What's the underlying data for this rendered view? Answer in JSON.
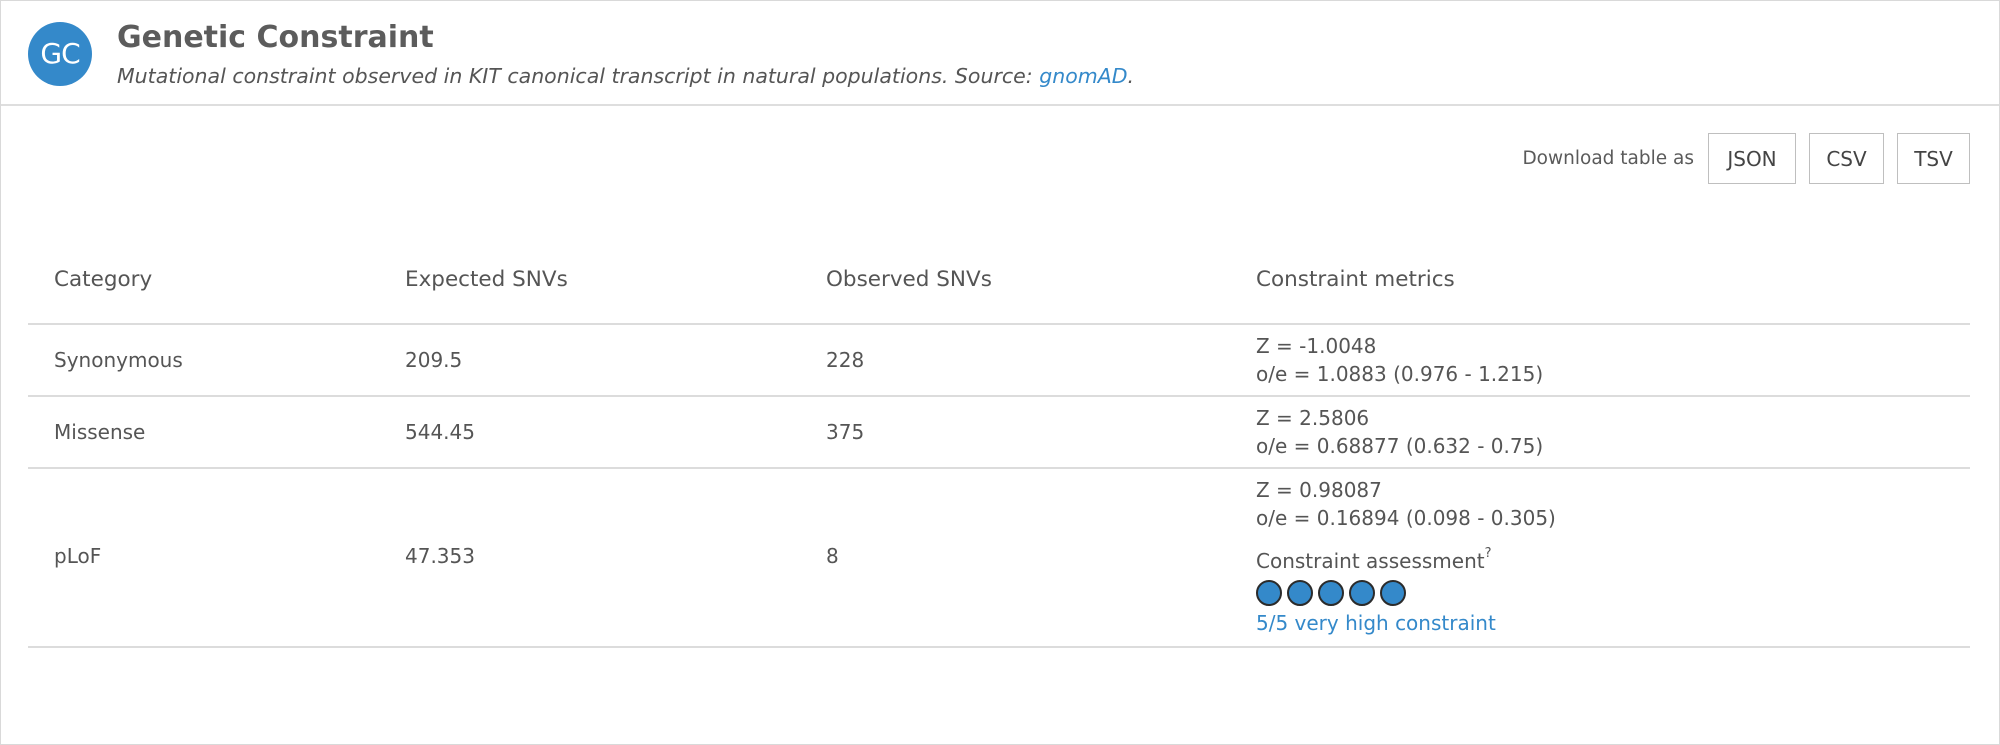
{
  "header": {
    "avatar_text": "GC",
    "title": "Genetic Constraint",
    "subtitle_prefix": "Mutational constraint observed in KIT canonical transcript in natural populations. Source: ",
    "subtitle_link": "gnomAD",
    "subtitle_suffix": "."
  },
  "download": {
    "label": "Download table as",
    "buttons": [
      "JSON",
      "CSV",
      "TSV"
    ]
  },
  "table": {
    "columns": [
      "Category",
      "Expected SNVs",
      "Observed SNVs",
      "Constraint metrics"
    ],
    "rows": [
      {
        "category": "Synonymous",
        "expected": "209.5",
        "observed": "228",
        "z": "Z = -1.0048",
        "oe": "o/e = 1.0883 (0.976 - 1.215)"
      },
      {
        "category": "Missense",
        "expected": "544.45",
        "observed": "375",
        "z": "Z = 2.5806",
        "oe": "o/e = 0.68877 (0.632 - 0.75)"
      },
      {
        "category": "pLoF",
        "expected": "47.353",
        "observed": "8",
        "z": "Z = 0.98087",
        "oe": "o/e = 0.16894 (0.098 - 0.305)"
      }
    ],
    "assessment": {
      "label": "Constraint assessment",
      "help_marker": "?",
      "score": 5,
      "max_score": 5,
      "text": "5/5 very high constraint"
    }
  },
  "colors": {
    "accent": "#3489ca",
    "text": "#555555",
    "border": "#dcdcdc"
  }
}
